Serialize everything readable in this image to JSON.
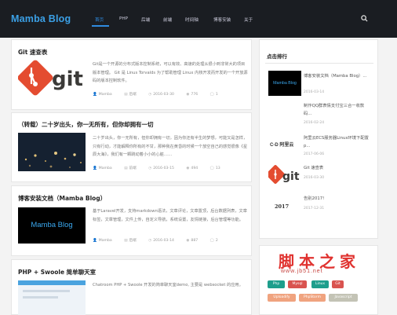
{
  "header": {
    "logo": "Mamba Blog",
    "nav": [
      "首页",
      "PHP",
      "后端",
      "前端",
      "时间轴",
      "博客安装",
      "关于"
    ]
  },
  "posts": [
    {
      "title": "Git 速查表",
      "thumb_text": "git",
      "excerpt": "Git是一个开源的分布式版本控制系统，可以有效、高速的处理从很小到非常大的项目版本管理。 Git 是 Linus Torvalds 为了帮助管理 Linux 内核开发而开发的一个开放源码的版本控制软件。",
      "author": "Mamba",
      "category": "后端",
      "date": "2016-03-30",
      "views": "776",
      "comments": "1"
    },
    {
      "title": "（转载）二十岁出头，你一无所有，但你却拥有一切",
      "excerpt": "二十岁出头，你一无所有，但你却拥有一切，因为你还有半生的梦想，可能又是怎样，只有行动，才能解释你所有的不甘，那种我在黄昏的时候一个放空自己的感觉很像《星辰大海》，我们有一颗跳动着小小的心脏……",
      "author": "Mamba",
      "category": "前端",
      "date": "2016-03-15",
      "views": "494",
      "comments": "13"
    },
    {
      "title": "博客安装文档（Mamba Blog）",
      "thumb_text": "Mamba Blog",
      "excerpt": "基于Laravel开发，支持markdown语法，文章评论，文章置顶，后台数据列表，文章标签，文章管理，文件上传，自定义导航，系统设置，友情链接，后台管理等功能。",
      "author": "Mamba",
      "category": "后端",
      "date": "2016-03-14",
      "views": "887",
      "comments": "2"
    },
    {
      "title": "PHP + Swoole 简单聊天室",
      "excerpt": "Chatroom PHP + Swoole 开发的简单聊天室demo, 主要是 websocket 的应用。"
    }
  ],
  "sidebar": {
    "title": "点击排行",
    "items": [
      {
        "title": "博客安装文档（Mamba Blog）...",
        "date": "2016-03-14",
        "thumb_text": "Mamba Blog"
      },
      {
        "title": "制作QQ群表情支付宝三合一收款码...",
        "date": "2016-02-24"
      },
      {
        "title": "阿里云ECS服务器Linux环境下配置p...",
        "date": "2017-06-06",
        "thumb_text": "C-D 阿里云"
      },
      {
        "title": "Git 速查表",
        "date": "2016-03-30",
        "thumb_text": "git"
      },
      {
        "title": "告别2017!",
        "date": "2017-12-31",
        "thumb_text": "2017"
      }
    ],
    "tags": [
      {
        "label": "Php",
        "color": "#1e9e8c"
      },
      {
        "label": "Mysql",
        "color": "#d9534f"
      },
      {
        "label": "Linux",
        "color": "#1e9e8c"
      },
      {
        "label": "Git",
        "color": "#d9534f"
      },
      {
        "label": "Uploadify",
        "color": "#f0a37f"
      },
      {
        "label": "PhpStorm",
        "color": "#f0a37f"
      },
      {
        "label": "Javascript",
        "color": "#c3c3b5"
      }
    ]
  },
  "watermark": {
    "main": "脚本之家",
    "url": "www.jb51.net"
  }
}
